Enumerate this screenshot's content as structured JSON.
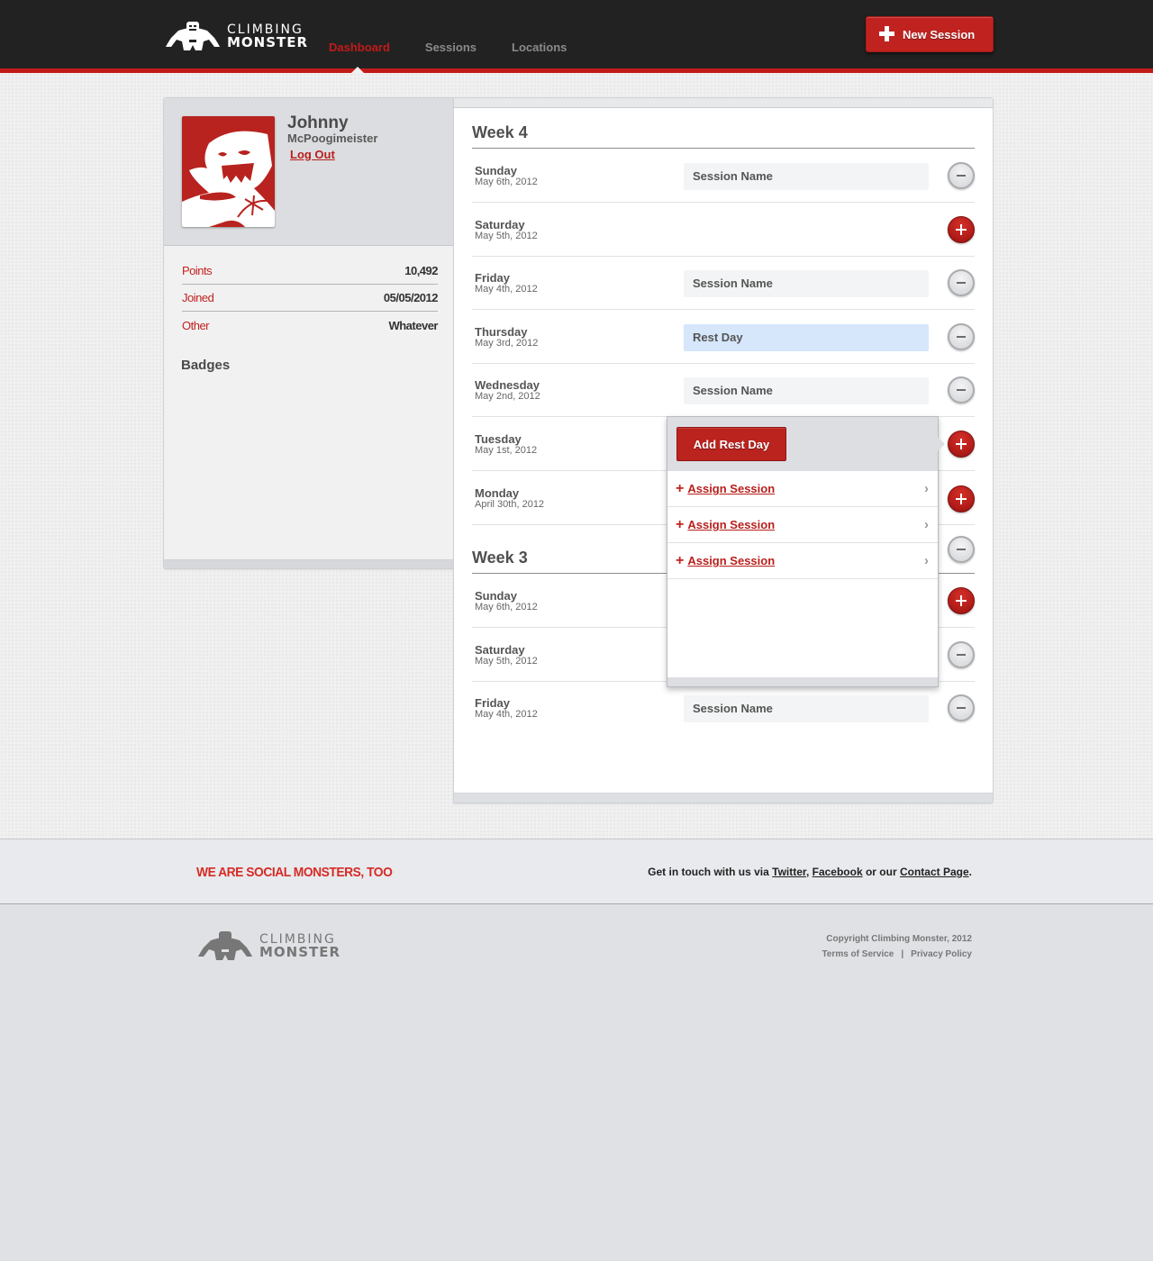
{
  "header": {
    "logo": {
      "line1": "CLIMBING",
      "line2": "MONSTER",
      "icon": "monster-logo-icon"
    },
    "nav": [
      {
        "label": "Dashboard",
        "active": true
      },
      {
        "label": "Sessions",
        "active": false
      },
      {
        "label": "Locations",
        "active": false
      }
    ],
    "new_session_label": "New Session",
    "accent_color": "#c21a1a"
  },
  "profile": {
    "first_name": "Johnny",
    "last_name": "McPoogimeister",
    "logout_label": "Log Out",
    "avatar_icon": "monster-avatar-icon",
    "stats": [
      {
        "label": "Points",
        "value": "10,492"
      },
      {
        "label": "Joined",
        "value": "05/05/2012"
      },
      {
        "label": "Other",
        "value": "Whatever"
      }
    ],
    "badges_title": "Badges"
  },
  "weeks": [
    {
      "title": "Week 4",
      "days": [
        {
          "day": "Sunday",
          "date": "May 6th, 2012",
          "field": "Session Name",
          "type": "session",
          "action": "remove"
        },
        {
          "day": "Saturday",
          "date": "May 5th, 2012",
          "field": null,
          "type": "empty",
          "action": "add"
        },
        {
          "day": "Friday",
          "date": "May 4th, 2012",
          "field": "Session Name",
          "type": "session",
          "action": "remove"
        },
        {
          "day": "Thursday",
          "date": "May 3rd, 2012",
          "field": "Rest Day",
          "type": "rest",
          "action": "remove"
        },
        {
          "day": "Wednesday",
          "date": "May 2nd, 2012",
          "field": "Session Name",
          "type": "session",
          "action": "remove"
        },
        {
          "day": "Tuesday",
          "date": "May 1st, 2012",
          "field": null,
          "type": "empty",
          "action": "add"
        },
        {
          "day": "Monday",
          "date": "April 30th, 2012",
          "field": null,
          "type": "empty",
          "action": "add"
        }
      ]
    },
    {
      "title": "Week 3",
      "days": [
        {
          "day": "Sunday",
          "date": "May 6th, 2012",
          "field": null,
          "type": "empty",
          "action": "add"
        },
        {
          "day": "Saturday",
          "date": "May 5th, 2012",
          "field": null,
          "type": "empty",
          "action": "remove"
        },
        {
          "day": "Friday",
          "date": "May 4th, 2012",
          "field": "Session Name",
          "type": "session",
          "action": "remove"
        }
      ]
    }
  ],
  "popover": {
    "add_rest_day_label": "Add Rest Day",
    "items": [
      {
        "label": "Assign Session"
      },
      {
        "label": "Assign Session"
      },
      {
        "label": "Assign Session"
      }
    ]
  },
  "footer": {
    "social_title": "WE ARE SOCIAL MONSTERS, TOO",
    "contact": {
      "prefix": "Get in touch with us via ",
      "twitter": "Twitter",
      "comma": ", ",
      "facebook": "Facebook",
      "middle": " or our ",
      "contact_page": "Contact Page",
      "suffix": "."
    },
    "logo": {
      "line1": "CLIMBING",
      "line2": "MONSTER"
    },
    "copyright": "Copyright Climbing Monster, 2012",
    "terms": "Terms of Service",
    "separator": "|",
    "privacy": "Privacy Policy"
  }
}
